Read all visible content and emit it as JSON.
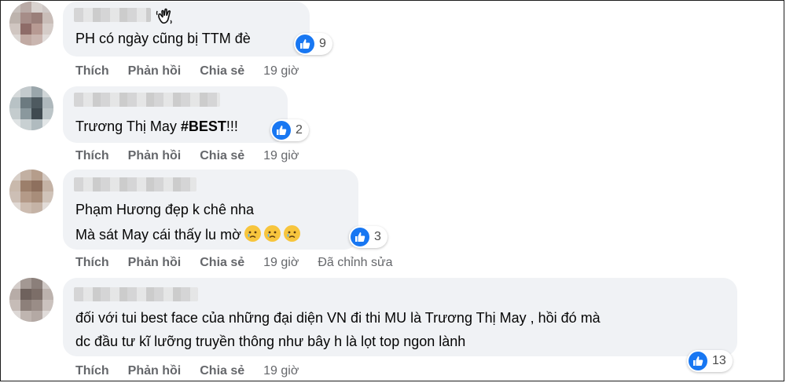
{
  "actions": {
    "like": "Thích",
    "reply": "Phản hồi",
    "share": "Chia sẻ"
  },
  "colors": {
    "like_blue": "#1877f2",
    "bubble_bg": "#f0f2f5",
    "meta_text": "#65676b"
  },
  "comments": [
    {
      "text": "PH có ngày cũng bị TTM đè",
      "likes": "9",
      "time": "19 giờ",
      "badge_icon": "waving-hand-icon"
    },
    {
      "text_prefix": "Trương Thị May ",
      "text_bold": "#BEST",
      "text_suffix": "!!!",
      "likes": "2",
      "time": "19 giờ"
    },
    {
      "line1": "Phạm Hương đẹp k chê nha",
      "line2": "Mà sát May cái thấy lu mờ",
      "emoji_icon": "crying-face-emoji-icon",
      "likes": "3",
      "time": "19 giờ",
      "edited": "Đã chỉnh sửa"
    },
    {
      "line1": "đối với tui best face của những đại diện VN đi thi MU là Trương Thị May , hồi đó mà",
      "line2": "dc đầu tư kĩ lưỡng truyền thông như bây h là lọt top ngon lành",
      "likes": "13",
      "time": "19 giờ"
    }
  ]
}
